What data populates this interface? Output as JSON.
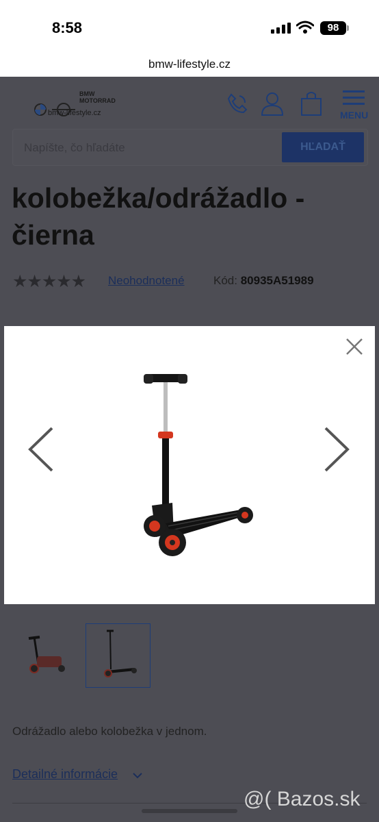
{
  "status_bar": {
    "time": "8:58",
    "battery": "98"
  },
  "browser": {
    "url": "bmw-lifestyle.cz"
  },
  "header": {
    "logo_brand": "BMW MOTORRAD",
    "logo_domain": "bmw-lifestyle.cz",
    "menu_label": "MENU",
    "icons": [
      "phone-icon",
      "user-icon",
      "cart-icon",
      "hamburger-menu-icon"
    ]
  },
  "search": {
    "placeholder": "Napíšte, čo hľadáte",
    "button_label": "HĽADAŤ"
  },
  "product": {
    "title_line1": "kolobežka/odrážadlo -",
    "title_line2": "čierna",
    "stars": "★★★★★",
    "rating_label": "Neohodnotené",
    "code_label": "Kód:",
    "code_value": "80935A51989",
    "description": "Odrážadlo alebo kolobežka v jednom.",
    "details_link": "Detailné informácie"
  },
  "modal": {
    "close": "close-icon",
    "prev": "chevron-left-icon",
    "next": "chevron-right-icon"
  },
  "watermark": "@( Bazos.sk",
  "colors": {
    "accent": "#1d3d78",
    "scooter_red": "#d4371f",
    "overlay": "#4c4c52"
  }
}
